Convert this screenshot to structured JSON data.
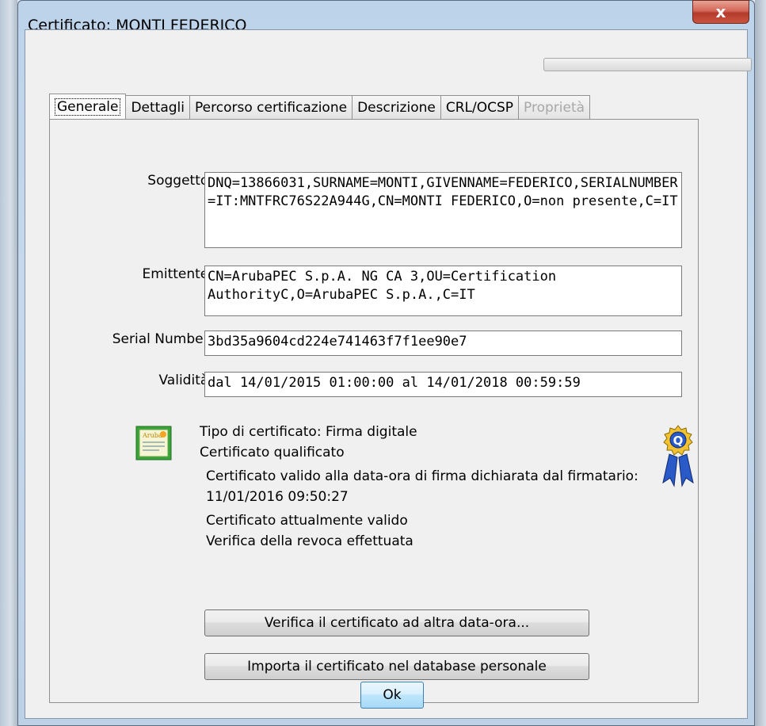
{
  "window": {
    "title": "Certificato: MONTI FEDERICO",
    "close_label": "x"
  },
  "tabs": [
    {
      "label": "Generale",
      "state": "active"
    },
    {
      "label": "Dettagli",
      "state": "normal"
    },
    {
      "label": "Percorso certificazione",
      "state": "normal"
    },
    {
      "label": "Descrizione",
      "state": "normal"
    },
    {
      "label": "CRL/OCSP",
      "state": "normal"
    },
    {
      "label": "Proprietà",
      "state": "disabled"
    }
  ],
  "fields": {
    "subject": {
      "label": "Soggetto:",
      "value": "DNQ=13866031,SURNAME=MONTI,GIVENNAME=FEDERICO,SERIALNUMBER=IT:MNTFRC76S22A944G,CN=MONTI FEDERICO,O=non presente,C=IT"
    },
    "issuer": {
      "label": "Emittente:",
      "value": "CN=ArubaPEC S.p.A. NG CA 3,OU=Certification AuthorityC,O=ArubaPEC S.p.A.,C=IT"
    },
    "serial": {
      "label": "Serial Number:",
      "value": "3bd35a9604cd224e741463f7f1ee90e7"
    },
    "validity": {
      "label": "Validità:",
      "value": "dal 14/01/2015 01:00:00 al 14/01/2018 00:59:59"
    }
  },
  "info": {
    "cert_type": "Tipo di certificato: Firma digitale",
    "qualified": "Certificato qualificato",
    "valid_at_line1": "Certificato valido alla data-ora di firma dichiarata dal firmatario:",
    "valid_at_line2": "11/01/2016 09:50:27",
    "currently_valid": "Certificato attualmente valido",
    "revocation_checked": "Verifica della revoca effettuata"
  },
  "icons": {
    "certificate_badge_text": "Aruba",
    "qualified_ribbon_letter": "Q"
  },
  "buttons": {
    "verify_other_date": "Verifica il certificato ad altra data-ora...",
    "import_personal_db": "Importa il certificato nel database personale",
    "ok": "Ok"
  },
  "colors": {
    "close_button": "#c9543f",
    "ok_button": "#bee6fd",
    "ribbon_blue": "#2a59c8",
    "ribbon_gold": "#f2c230",
    "cert_green": "#3aa43a"
  }
}
